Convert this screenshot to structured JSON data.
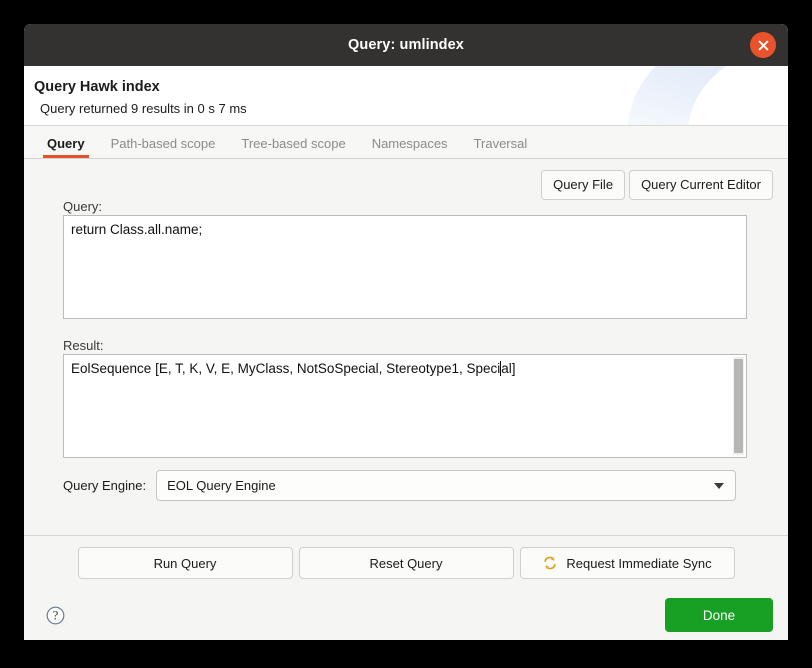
{
  "window": {
    "title": "Query: umlindex",
    "close_icon": "close-icon"
  },
  "header": {
    "title": "Query Hawk index",
    "subtitle": "Query returned 9 results in 0 s 7 ms"
  },
  "tabs": [
    {
      "label": "Query",
      "active": true
    },
    {
      "label": "Path-based scope",
      "active": false
    },
    {
      "label": "Tree-based scope",
      "active": false
    },
    {
      "label": "Namespaces",
      "active": false
    },
    {
      "label": "Traversal",
      "active": false
    }
  ],
  "toolbar": {
    "query_file_label": "Query File",
    "query_current_editor_label": "Query Current Editor"
  },
  "query": {
    "label": "Query:",
    "value": "return Class.all.name;"
  },
  "result": {
    "label": "Result:",
    "value_before_caret": "EolSequence [E, T, K, V, E, MyClass, NotSoSpecial, Stereotype1, Speci",
    "value_after_caret": "al]"
  },
  "engine": {
    "label": "Query Engine:",
    "selected": "EOL Query Engine",
    "options": [
      "EOL Query Engine"
    ],
    "arrow_icon": "chevron-down-icon"
  },
  "actions": {
    "run_query_label": "Run Query",
    "reset_query_label": "Reset Query",
    "sync_label": "Request Immediate Sync",
    "sync_icon": "sync-icon"
  },
  "footer": {
    "help_icon": "help-circle-icon",
    "done_label": "Done"
  },
  "colors": {
    "titlebar": "#343230",
    "close": "#e9522a",
    "accent": "#e8502a",
    "done": "#17a024",
    "panel": "#f5f5f4"
  }
}
